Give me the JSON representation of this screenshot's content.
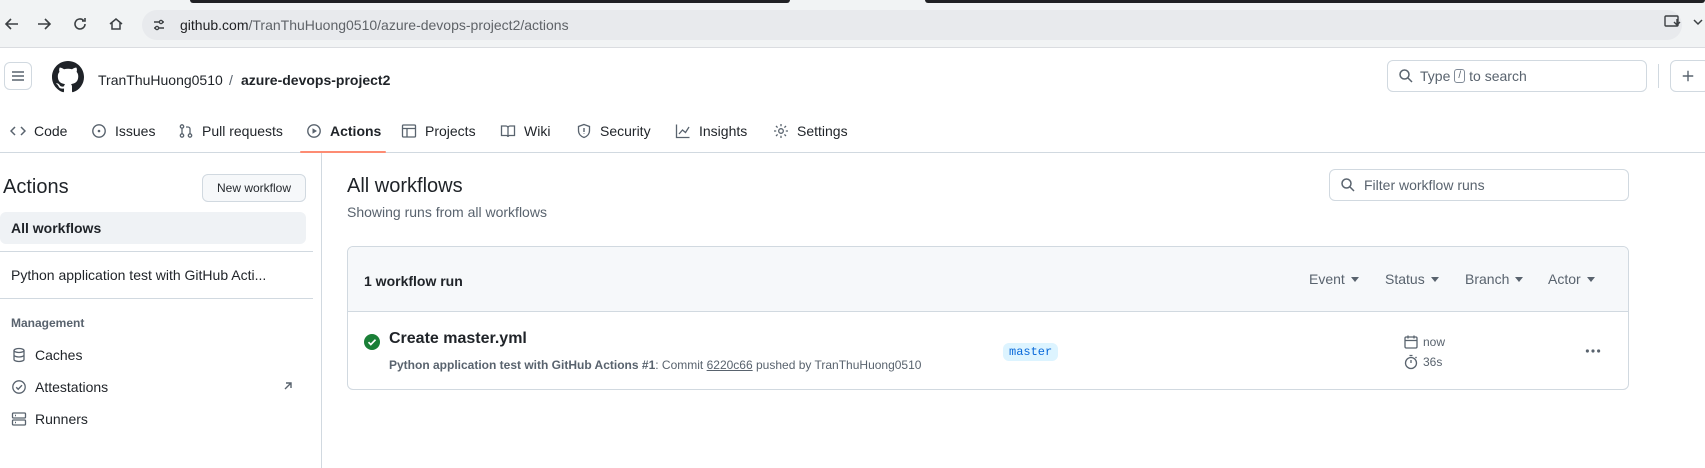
{
  "browser": {
    "url_host": "github.com",
    "url_path": "/TranThuHuong0510/azure-devops-project2/actions"
  },
  "header": {
    "owner": "TranThuHuong0510",
    "separator": "/",
    "repo": "azure-devops-project2",
    "search_prefix": "Type",
    "search_key": "/",
    "search_suffix": "to search"
  },
  "repo_nav": [
    {
      "label": "Code",
      "icon": "code-icon"
    },
    {
      "label": "Issues",
      "icon": "issue-icon"
    },
    {
      "label": "Pull requests",
      "icon": "pull-request-icon"
    },
    {
      "label": "Actions",
      "icon": "play-icon",
      "selected": true
    },
    {
      "label": "Projects",
      "icon": "table-icon"
    },
    {
      "label": "Wiki",
      "icon": "book-icon"
    },
    {
      "label": "Security",
      "icon": "shield-icon"
    },
    {
      "label": "Insights",
      "icon": "graph-icon"
    },
    {
      "label": "Settings",
      "icon": "gear-icon"
    }
  ],
  "sidebar": {
    "title": "Actions",
    "new_workflow": "New workflow",
    "all_workflows": "All workflows",
    "workflow": "Python application test with GitHub Acti...",
    "management_heading": "Management",
    "links": [
      {
        "label": "Caches",
        "icon": "database-icon"
      },
      {
        "label": "Attestations",
        "icon": "verified-icon"
      },
      {
        "label": "Runners",
        "icon": "server-icon"
      }
    ]
  },
  "main": {
    "title": "All workflows",
    "subtitle": "Showing runs from all workflows",
    "filter_placeholder": "Filter workflow runs",
    "runs_count": "1 workflow run",
    "filters": [
      "Event",
      "Status",
      "Branch",
      "Actor"
    ],
    "run": {
      "title": "Create master.yml",
      "workflow_name": "Python application test with GitHub Actions",
      "run_number": "#1",
      "commit_prefix": ": Commit",
      "sha": "6220c66",
      "pushed_by": "pushed by TranThuHuong0510",
      "branch": "master",
      "time": "now",
      "duration": "36s",
      "status_color": "#1a7f37"
    }
  }
}
